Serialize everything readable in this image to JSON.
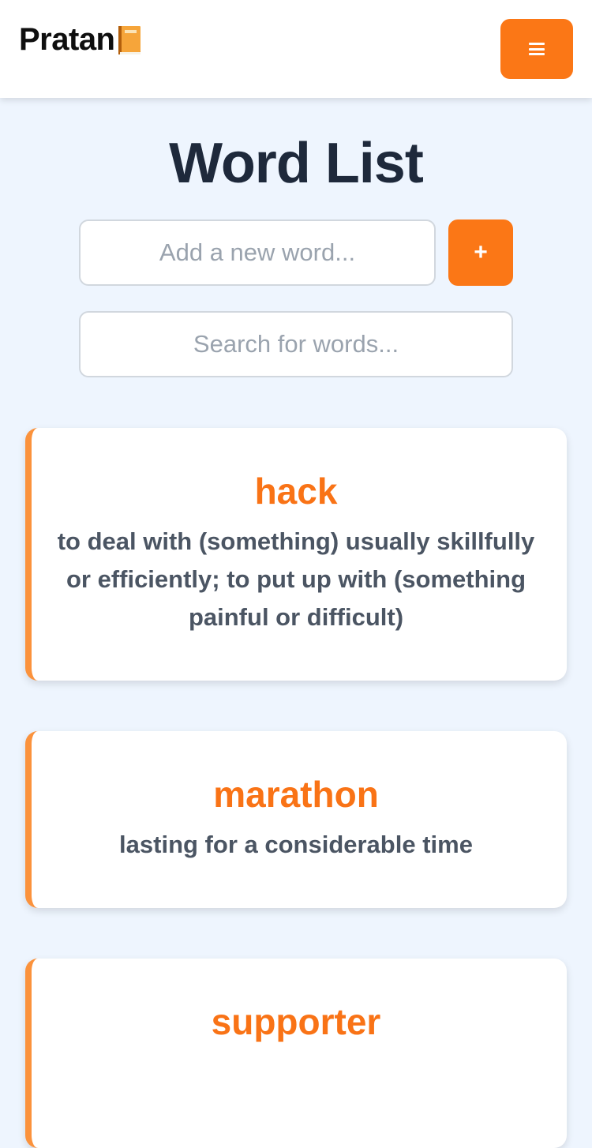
{
  "header": {
    "brand": "Pratan",
    "brand_icon": "book-icon",
    "menu_icon": "hamburger-icon",
    "accent_color": "#fb7716"
  },
  "main": {
    "title": "Word List",
    "add_input": {
      "placeholder": "Add a new word...",
      "value": ""
    },
    "add_button_label": "+",
    "search_input": {
      "placeholder": "Search for words...",
      "value": ""
    }
  },
  "words": [
    {
      "term": "hack",
      "definition": "to deal with (something) usually skillfully or efficiently; to put up with (something painful or difficult)"
    },
    {
      "term": "marathon",
      "definition": "lasting for a considerable time"
    },
    {
      "term": "supporter",
      "definition": ""
    }
  ],
  "colors": {
    "background": "#eef5fe",
    "term": "#f97316",
    "card_border": "#fb923c",
    "definition": "#4b5563",
    "title": "#1e293b"
  }
}
